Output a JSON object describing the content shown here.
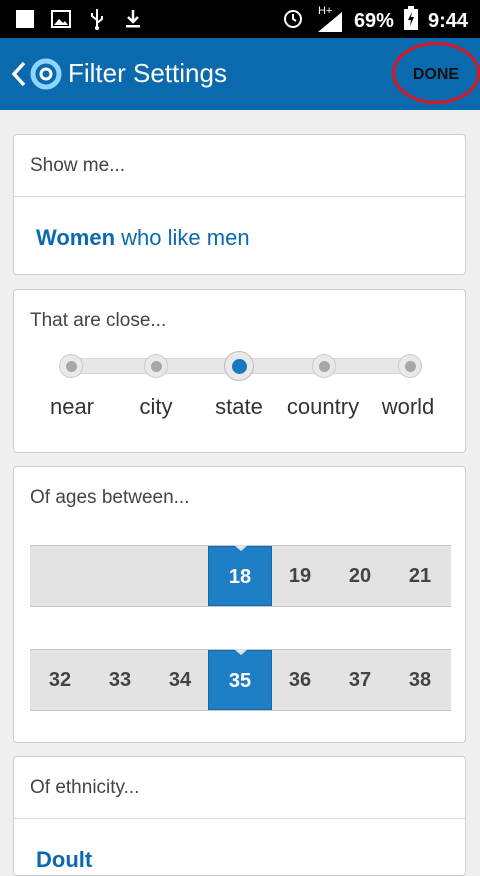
{
  "status_bar": {
    "battery": "69%",
    "time": "9:44",
    "network": "H+"
  },
  "app_bar": {
    "title": "Filter Settings",
    "done_label": "DONE"
  },
  "show_me": {
    "label": "Show me...",
    "value_bold": "Women",
    "value_rest": " who like men"
  },
  "distance": {
    "label": "That are close...",
    "options": [
      "near",
      "city",
      "state",
      "country",
      "world"
    ],
    "selected": "state"
  },
  "ages": {
    "label": "Of ages between...",
    "min_row": [
      "18",
      "19",
      "20",
      "21"
    ],
    "min_selected": "18",
    "max_row": [
      "32",
      "33",
      "34",
      "35",
      "36",
      "37",
      "38"
    ],
    "max_selected": "35"
  },
  "ethnicity": {
    "label": "Of ethnicity...",
    "value_partial": "Doult"
  },
  "colors": {
    "primary": "#0a6aad",
    "selected": "#1e7fc6",
    "annotation": "#e0141e"
  }
}
